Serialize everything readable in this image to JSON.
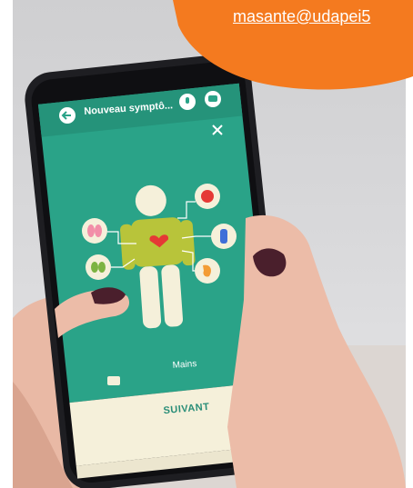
{
  "banner": {
    "email": "masante@udapei5",
    "color": "#f47a1f"
  },
  "app": {
    "title": "Nouveau symptô...",
    "body_part_label": "Mains",
    "next_button_label": "SUIVANT",
    "primary_color": "#2aa388",
    "accent_body_color": "#b8c43a"
  },
  "icons": [
    "back-arrow-icon",
    "microphone-icon",
    "chat-icon",
    "close-icon",
    "lungs-icon",
    "heart-organ-icon",
    "kidneys-icon",
    "body-vein-icon",
    "stomach-icon",
    "heart-icon",
    "speech-bubble-icon"
  ]
}
